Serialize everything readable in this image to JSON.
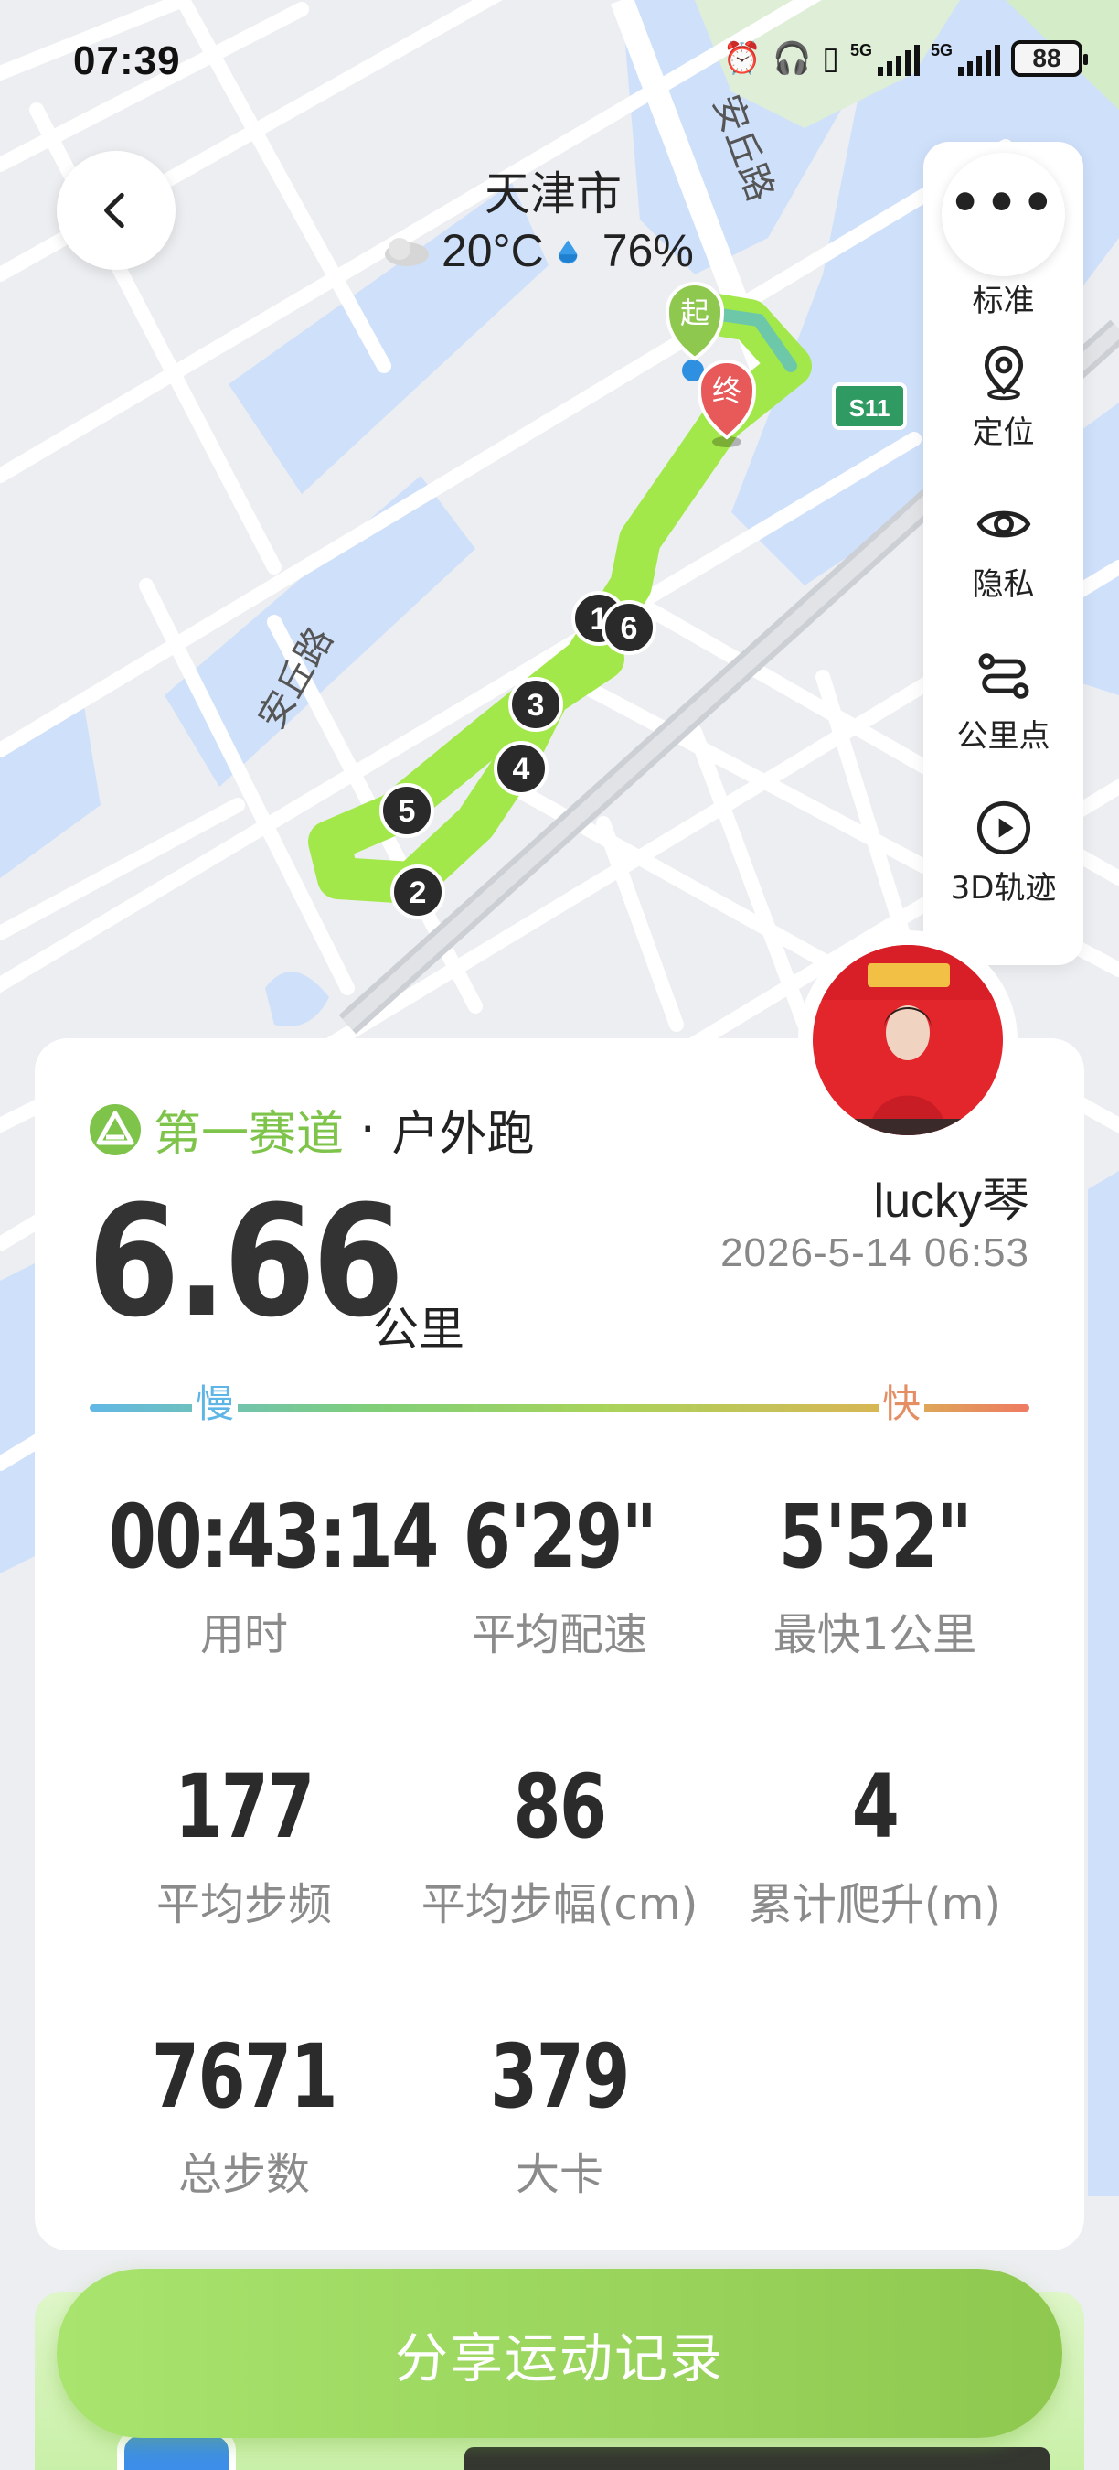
{
  "status_bar": {
    "time": "07:39",
    "icons": [
      "alarm-icon",
      "headphones-icon",
      "vibrate-icon",
      "signal-5g-icon",
      "signal-5g-icon"
    ],
    "network_1": "5G",
    "network_2": "5G",
    "battery": "88"
  },
  "map": {
    "city": "天津市",
    "temperature": "20°C",
    "humidity": "76%",
    "road_label_1": "安丘路",
    "road_label_2": "安丘路",
    "highway_badge": "S11",
    "start_label": "起",
    "end_label": "终",
    "km_markers": [
      "1",
      "2",
      "3",
      "4",
      "5",
      "6"
    ],
    "route_color": "#a3e84a"
  },
  "toolbar": {
    "more": "•••",
    "items": [
      {
        "label": "标准",
        "icon": "map-style-icon"
      },
      {
        "label": "定位",
        "icon": "location-pin-icon"
      },
      {
        "label": "隐私",
        "icon": "eye-icon"
      },
      {
        "label": "公里点",
        "icon": "route-points-icon"
      },
      {
        "label": "3D轨迹",
        "icon": "play-icon"
      }
    ]
  },
  "summary": {
    "brand": "第一赛道",
    "separator": "·",
    "activity_type": "户外跑",
    "distance": "6.66",
    "distance_unit": "公里",
    "username": "lucky琴",
    "datetime": "2026-5-14 06:53",
    "pace_slow": "慢",
    "pace_fast": "快"
  },
  "stats": [
    {
      "value": "00:43:14",
      "label": "用时"
    },
    {
      "value": "6'29\"",
      "label": "平均配速"
    },
    {
      "value": "5'52\"",
      "label": "最快1公里"
    },
    {
      "value": "177",
      "label": "平均步频"
    },
    {
      "value": "86",
      "label": "平均步幅(cm)"
    },
    {
      "value": "4",
      "label": "累计爬升(m)"
    },
    {
      "value": "7671",
      "label": "总步数"
    },
    {
      "value": "379",
      "label": "大卡"
    }
  ],
  "share": {
    "label": "分享运动记录"
  },
  "colors": {
    "accent_green": "#7ec34a",
    "route_green": "#a3e84a",
    "water": "#cfe0fb",
    "start_marker": "#8fc84f",
    "end_marker": "#e85a5a"
  }
}
